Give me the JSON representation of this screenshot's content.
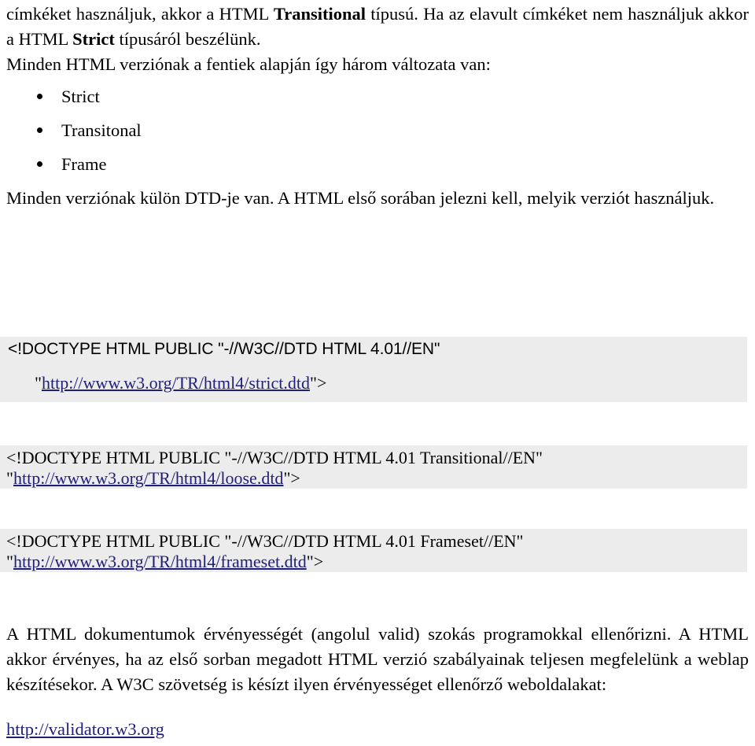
{
  "document": {
    "language": "hu",
    "paragraphs": {
      "intro_continuation_pre_bold1": "címkéket használjuk, akkor a HTML ",
      "intro_bold1": "Transitional",
      "intro_mid": " típusú. Ha az elavult címkéket nem használjuk akkor a HTML ",
      "intro_bold2": "Strict",
      "intro_tail": " típusáról beszélünk.",
      "versions_intro": "Minden HTML verziónak a fentiek alapján így három változata van:",
      "dtd_note": "Minden verziónak külön DTD-je van. A HTML első sorában jelezni kell, melyik verziót használjuk.",
      "validation": "A HTML dokumentumok érvényességét (angolul valid) szokás programokkal ellenőrizni. A HTML akkor érvényes, ha az első sorban megadott HTML verzió szabályainak teljesen megfelelünk a weblap készítésekor. A W3C szövetség is késízt ilyen érvényességet ellenőrző weboldalakat:"
    },
    "bullet_list": [
      {
        "label": "Strict"
      },
      {
        "label": "Transitonal"
      },
      {
        "label": "Frame"
      }
    ],
    "code_blocks": [
      {
        "name": "doctype-strict",
        "declaration": "<!DOCTYPE HTML PUBLIC \"-//W3C//DTD HTML 4.01//EN\"",
        "open_quote": "\"",
        "url": "http://www.w3.org/TR/html4/strict.dtd",
        "close": "\">"
      },
      {
        "name": "doctype-transitional",
        "declaration": "<!DOCTYPE HTML PUBLIC \"-//W3C//DTD HTML 4.01 Transitional//EN\"",
        "open_quote": "\"",
        "url": "http://www.w3.org/TR/html4/loose.dtd",
        "close": "\">"
      },
      {
        "name": "doctype-frameset",
        "declaration": "<!DOCTYPE HTML PUBLIC \"-//W3C//DTD HTML 4.01 Frameset//EN\"",
        "open_quote": "\"",
        "url": "http://www.w3.org/TR/html4/frameset.dtd",
        "close": "\">"
      }
    ],
    "validator_link": "http://validator.w3.org",
    "colors": {
      "text": "#000000",
      "link": "#1f1f7a",
      "code_background": "#ececec",
      "page_background": "#ffffff"
    }
  }
}
